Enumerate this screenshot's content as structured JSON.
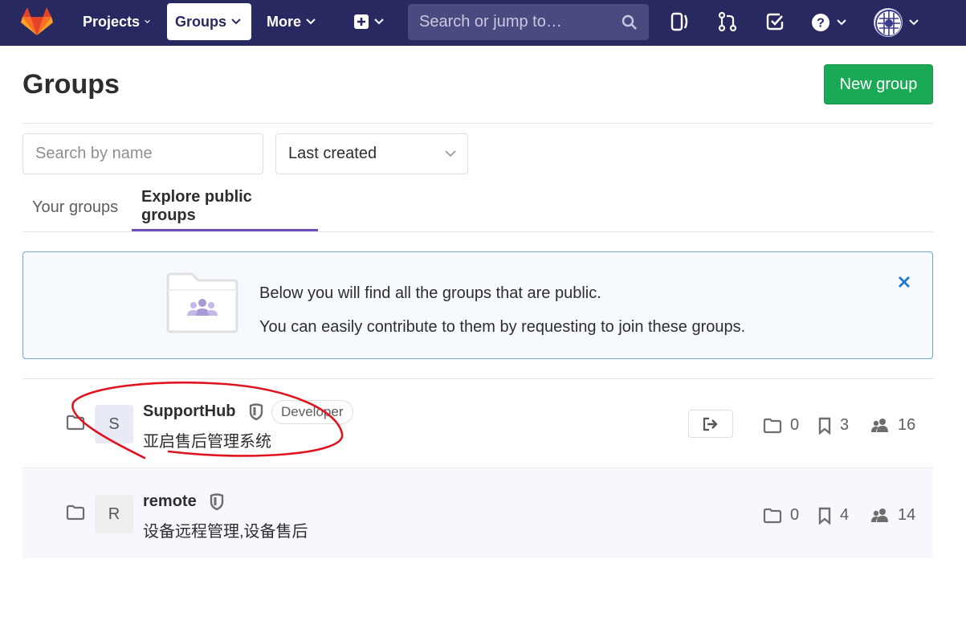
{
  "navbar": {
    "items": [
      {
        "label": "Projects"
      },
      {
        "label": "Groups"
      },
      {
        "label": "More"
      }
    ],
    "search_placeholder": "Search or jump to…",
    "icons": [
      "gitlab-logo",
      "plus-square-icon",
      "search-icon",
      "issues-icon",
      "merge-request-icon",
      "todo-check-icon",
      "help-icon",
      "user-avatar"
    ]
  },
  "page": {
    "title": "Groups",
    "new_group_label": "New group"
  },
  "filters": {
    "search_placeholder": "Search by name",
    "sort_value": "Last created"
  },
  "tabs": [
    {
      "label": "Your groups"
    },
    {
      "label": "Explore public groups"
    }
  ],
  "banner": {
    "line1": "Below you will find all the groups that are public.",
    "line2": "You can easily contribute to them by requesting to join these groups."
  },
  "groups": [
    {
      "avatar_letter": "S",
      "name": "SupportHub",
      "role": "Developer",
      "description": "亚启售后管理系统",
      "subgroups": "0",
      "projects": "3",
      "members": "16"
    },
    {
      "avatar_letter": "R",
      "name": "remote",
      "description": "设备远程管理,设备售后",
      "subgroups": "0",
      "projects": "4",
      "members": "14"
    }
  ],
  "colors": {
    "navbar": "#292961",
    "primary_button": "#1aaa55",
    "active_tab_underline": "#6b4fbb",
    "banner_border": "#74a6d6",
    "annotation": "#e0141e"
  }
}
